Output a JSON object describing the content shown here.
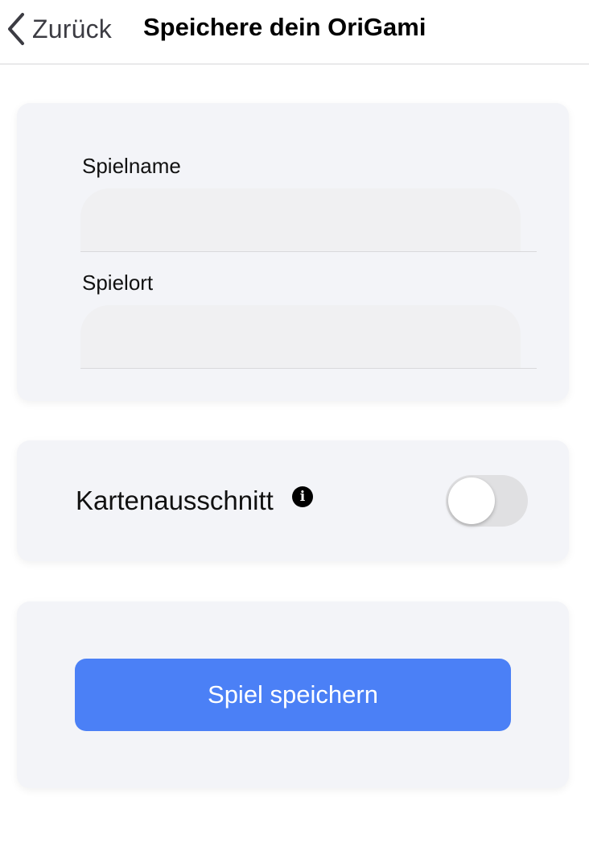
{
  "navbar": {
    "back_label": "Zurück",
    "title": "Speichere dein OriGami",
    "back_icon": "chevron-left-icon"
  },
  "form": {
    "game_name": {
      "label": "Spielname",
      "value": "",
      "placeholder": ""
    },
    "game_location": {
      "label": "Spielort",
      "value": "",
      "placeholder": ""
    }
  },
  "map_section": {
    "label": "Kartenausschnitt",
    "info_icon": "info-icon",
    "info_glyph": "i",
    "toggle_on": false
  },
  "actions": {
    "save_label": "Spiel speichern"
  },
  "colors": {
    "accent": "#4b80f6",
    "card_background": "#f3f4f8",
    "input_background": "#f0f0f2",
    "toggle_off": "#e0e0e2"
  }
}
